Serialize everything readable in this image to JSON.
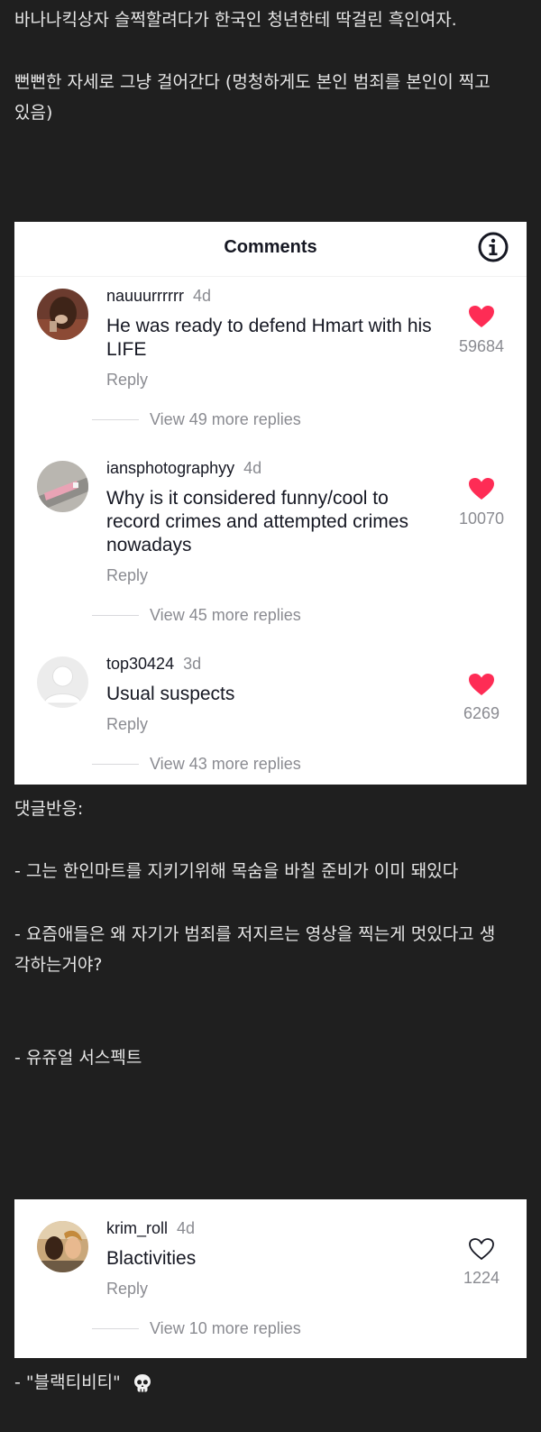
{
  "post": {
    "line1": "바나나킥상자 슬쩍할려다가 한국인 청년한테 딱걸린 흑인여자.",
    "line2": "뻔뻔한 자세로 그냥 걸어간다 (멍청하게도 본인 범죄를 본인이 찍고",
    "line3": "있음)"
  },
  "comments_panel": {
    "title": "Comments",
    "comments": [
      {
        "username": "nauuurrrrrr",
        "age": "4d",
        "text": "He was ready to defend Hmart with his LIFE",
        "reply": "Reply",
        "likes": "59684",
        "more": "View 49 more replies"
      },
      {
        "username": "iansphotographyy",
        "age": "4d",
        "text": "Why is it considered funny/cool to record crimes and attempted crimes nowadays",
        "reply": "Reply",
        "likes": "10070",
        "more": "View 45 more replies"
      },
      {
        "username": "top30424",
        "age": "3d",
        "text": "Usual suspects",
        "reply": "Reply",
        "likes": "6269",
        "more": "View 43 more replies"
      }
    ]
  },
  "reactions": {
    "heading": "댓글반응:",
    "r1": "- 그는 한인마트를 지키기위해 목숨을 바칠 준비가 이미 돼있다",
    "r2a": "- 요즘애들은 왜 자기가 범죄를 저지르는 영상을 찍는게 멋있다고 생",
    "r2b": "각하는거야?",
    "r3": "- 유쥬얼 서스펙트"
  },
  "second_comment": {
    "username": "krim_roll",
    "age": "4d",
    "text": "Blactivities",
    "reply": "Reply",
    "likes": "1224",
    "more": "View 10 more replies"
  },
  "footer": {
    "text": "- \"블랙티비티\""
  },
  "colors": {
    "background": "#1f1f1f",
    "heart_red": "#fe2c55",
    "muted": "#8a8b91"
  }
}
